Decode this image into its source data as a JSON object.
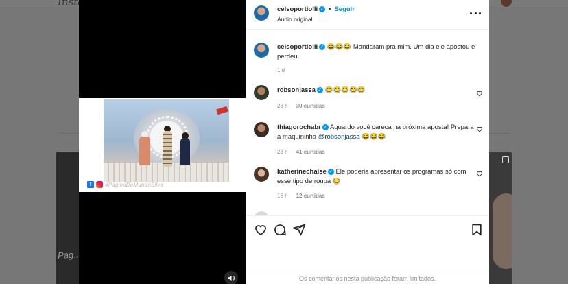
{
  "background": {
    "logo_text": "Insta",
    "watermark_text": "Pag..."
  },
  "post": {
    "video_watermark": "#PaginaDoMundoSilva",
    "username": "celsoportiolli",
    "separator": "•",
    "follow_label": "Seguir",
    "audio_label": "Áudio original"
  },
  "comments": [
    {
      "username": "celsoportiolli",
      "text": "😂😂😂 Mandaram pra mim. Um dia ele apostou e perdeu.",
      "time": "1 d",
      "likes": ""
    },
    {
      "username": "robsonjassa",
      "text": "😂😂😂😂😂",
      "time": "23 h",
      "likes": "30 curtidas"
    },
    {
      "username": "thiagorochabr",
      "text_before": "Aguardo você careca na próxima aposta! Prepara a maquininha ",
      "mention": "@robsonjassa",
      "text_after": " 😂😂😂",
      "time": "23 h",
      "likes": "41 curtidas"
    },
    {
      "username": "katherinechaise",
      "text": "Ele poderia apresentar os programas só com esse tipo de roupa 😂",
      "time": "16 h",
      "likes": "12 curtidas"
    }
  ],
  "footer": {
    "limited_text": "Os comentários nesta publicação foram limitados."
  },
  "colors": {
    "accent": "#0095f6",
    "verified": "#0095f6",
    "text": "#262626",
    "muted": "#8e8e8e"
  }
}
